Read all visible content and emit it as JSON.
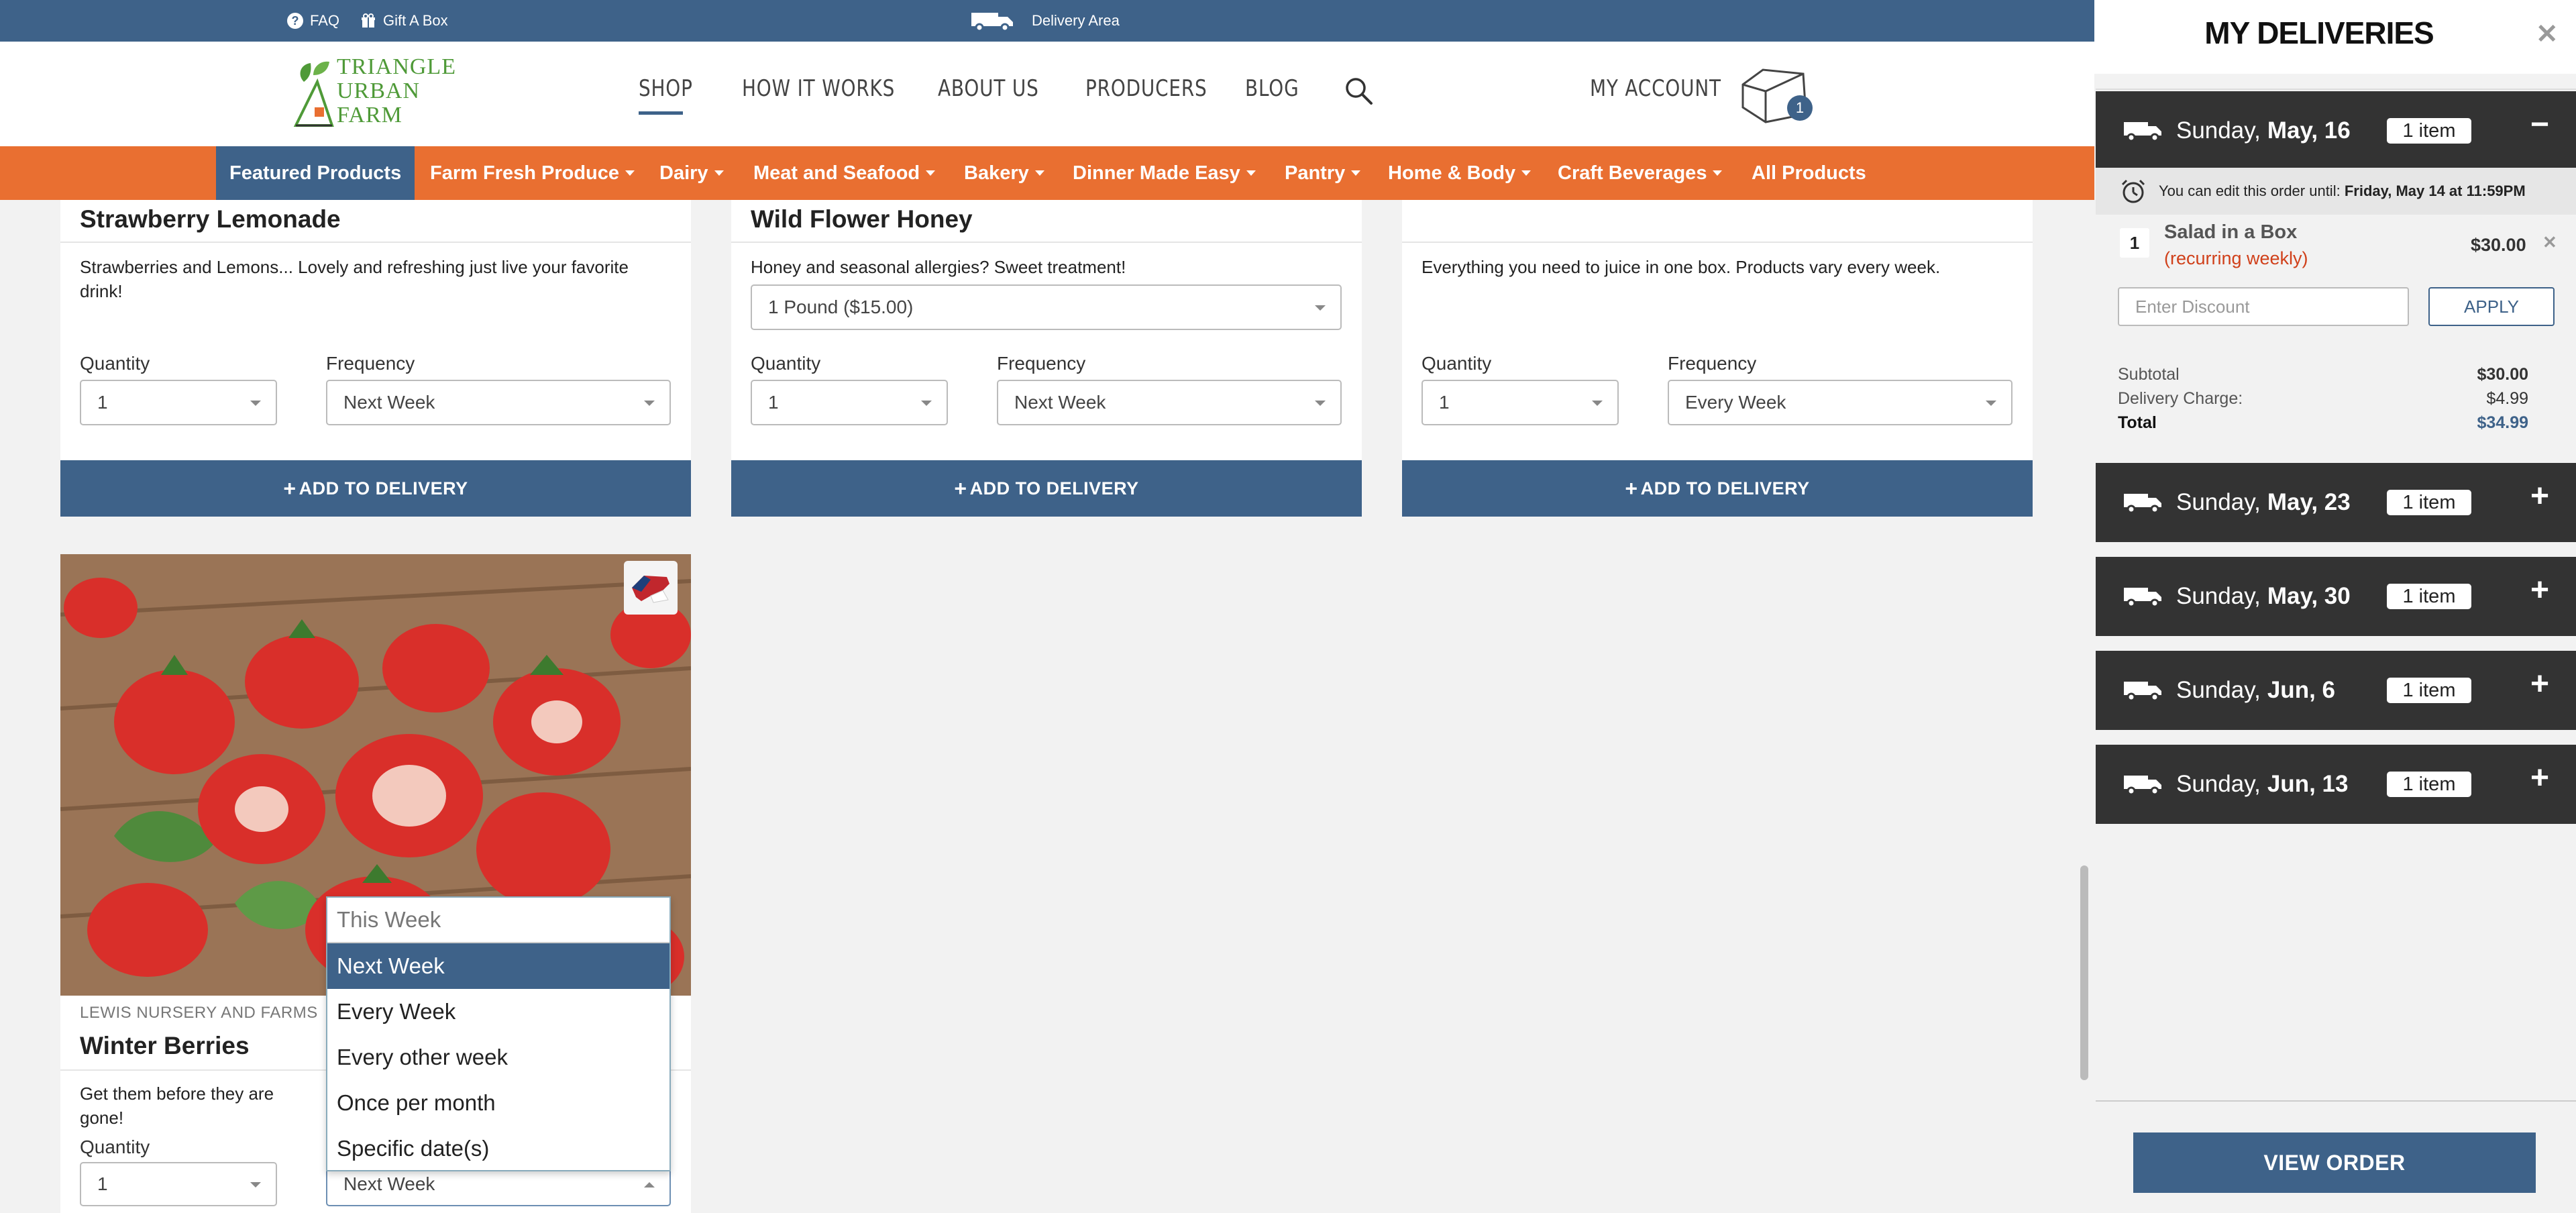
{
  "utility": {
    "faq": "FAQ",
    "gift": "Gift A Box",
    "delivery_area": "Delivery Area"
  },
  "brand": {
    "line1": "TRIANGLE",
    "line2": "URBAN",
    "line3": "FARM"
  },
  "nav": {
    "shop": "SHOP",
    "how": "HOW IT WORKS",
    "about": "ABOUT US",
    "producers": "PRODUCERS",
    "blog": "BLOG",
    "account": "MY ACCOUNT",
    "cart_count": "1"
  },
  "categories": [
    "Featured Products",
    "Farm Fresh Produce",
    "Dairy",
    "Meat and Seafood",
    "Bakery",
    "Dinner Made Easy",
    "Pantry",
    "Home & Body",
    "Craft Beverages",
    "All Products"
  ],
  "products": [
    {
      "title": "Strawberry Lemonade",
      "desc": "Strawberries and Lemons... Lovely and refreshing just live your favorite drink!",
      "qty_label": "Quantity",
      "qty": "1",
      "freq_label": "Frequency",
      "freq": "Next Week",
      "add": "ADD TO DELIVERY"
    },
    {
      "title": "Wild Flower Honey",
      "desc": "Honey and seasonal allergies? Sweet treatment!",
      "variant": "1 Pound ($15.00)",
      "qty_label": "Quantity",
      "qty": "1",
      "freq_label": "Frequency",
      "freq": "Next Week",
      "add": "ADD TO DELIVERY"
    },
    {
      "desc": "Everything you need to juice in one box. Products vary every week.",
      "qty_label": "Quantity",
      "qty": "1",
      "freq_label": "Frequency",
      "freq": "Every Week",
      "add": "ADD TO DELIVERY"
    },
    {
      "producer": "LEWIS NURSERY AND FARMS",
      "title": "Winter Berries",
      "desc": "Get them before they are gone!",
      "qty_label": "Quantity",
      "qty": "1",
      "freq": "Next Week"
    }
  ],
  "frequency_options": [
    "This Week",
    "Next Week",
    "Every Week",
    "Every other week",
    "Once per month",
    "Specific date(s)"
  ],
  "panel": {
    "title": "MY DELIVERIES",
    "deliveries": [
      {
        "day": "Sunday,",
        "date": "May, 16",
        "count": "1 item",
        "toggle": "−"
      },
      {
        "day": "Sunday,",
        "date": "May, 23",
        "count": "1 item",
        "toggle": "+"
      },
      {
        "day": "Sunday,",
        "date": "May, 30",
        "count": "1 item",
        "toggle": "+"
      },
      {
        "day": "Sunday,",
        "date": "Jun, 6",
        "count": "1 item",
        "toggle": "+"
      },
      {
        "day": "Sunday,",
        "date": "Jun, 13",
        "count": "1 item",
        "toggle": "+"
      }
    ],
    "edit_note": "You can edit this order until:",
    "edit_deadline": "Friday, May 14 at 11:59PM",
    "item": {
      "qty": "1",
      "name": "Salad in a Box",
      "recur": "(recurring weekly)",
      "price": "$30.00"
    },
    "discount_placeholder": "Enter Discount",
    "apply": "APPLY",
    "subtotal_label": "Subtotal",
    "subtotal": "$30.00",
    "delivery_label": "Delivery Charge:",
    "delivery": "$4.99",
    "total_label": "Total",
    "total": "$34.99",
    "view_order": "VIEW ORDER"
  },
  "colors": {
    "brand_blue": "#3e6289",
    "accent_orange": "#e96f31",
    "dark_bar": "#333333",
    "recurring_red": "#d0401a"
  }
}
